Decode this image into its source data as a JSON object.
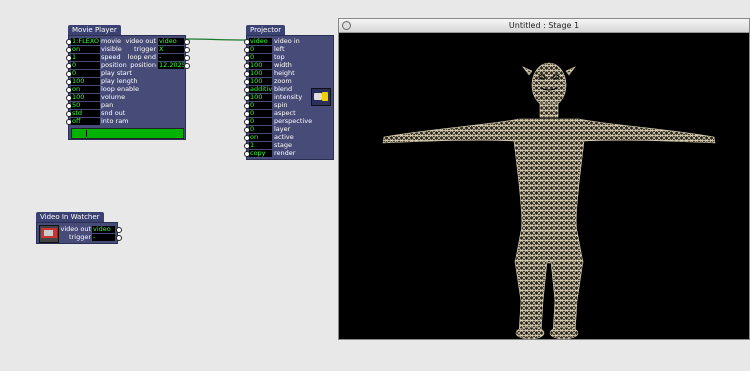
{
  "movie_player": {
    "title": "Movie Player",
    "inputs": [
      {
        "value": "1:FLEXO",
        "label": "movie"
      },
      {
        "value": "on",
        "label": "visible"
      },
      {
        "value": "1",
        "label": "speed"
      },
      {
        "value": "0",
        "label": "position"
      },
      {
        "value": "0",
        "label": "play start"
      },
      {
        "value": "100",
        "label": "play length"
      },
      {
        "value": "on",
        "label": "loop enable"
      },
      {
        "value": "100",
        "label": "volume"
      },
      {
        "value": "50",
        "label": "pan"
      },
      {
        "value": "std",
        "label": "snd out"
      },
      {
        "value": "off",
        "label": "into ram"
      }
    ],
    "outputs": [
      {
        "label": "video out",
        "value": "video"
      },
      {
        "label": "trigger",
        "value": "X"
      },
      {
        "label": "loop end",
        "value": "-"
      },
      {
        "label": "position",
        "value": "12.2025"
      }
    ],
    "progress": 0.13
  },
  "projector": {
    "title": "Projector",
    "inputs": [
      {
        "value": "video",
        "label": "video in"
      },
      {
        "value": "0",
        "label": "left"
      },
      {
        "value": "0",
        "label": "top"
      },
      {
        "value": "100",
        "label": "width"
      },
      {
        "value": "100",
        "label": "height"
      },
      {
        "value": "100",
        "label": "zoom"
      },
      {
        "value": "additive",
        "label": "blend"
      },
      {
        "value": "100",
        "label": "intensity"
      },
      {
        "value": "0",
        "label": "spin"
      },
      {
        "value": "0",
        "label": "aspect"
      },
      {
        "value": "0",
        "label": "perspective"
      },
      {
        "value": "0",
        "label": "layer"
      },
      {
        "value": "on",
        "label": "active"
      },
      {
        "value": "1",
        "label": "stage"
      },
      {
        "value": "copy",
        "label": "render"
      }
    ]
  },
  "video_watcher": {
    "title": "Video In Watcher",
    "outputs": [
      {
        "label": "video out",
        "value": "video"
      },
      {
        "label": "trigger",
        "value": "-"
      }
    ]
  },
  "stage": {
    "title": "Untitled : Stage 1"
  },
  "colors": {
    "actor_body": "#474b78",
    "value_text": "#33ff33",
    "connection": "#1a7a2e",
    "mesh": "#e8dcc0"
  }
}
